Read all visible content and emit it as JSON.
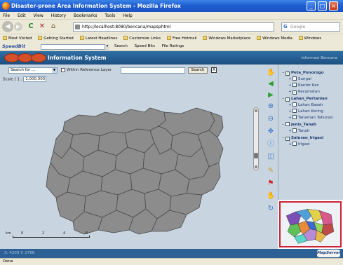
{
  "window": {
    "title": "Disaster-prone Area Information System - Mozilla Firefox",
    "min": "_",
    "max": "□",
    "close": "×"
  },
  "menu": [
    "File",
    "Edit",
    "View",
    "History",
    "Bookmarks",
    "Tools",
    "Help"
  ],
  "nav": {
    "back": "◀",
    "forward": "▶",
    "reload": "C",
    "stop": "✕",
    "home": "⌂",
    "url": "http://localhost:8080/bencana/mapsphtml",
    "star": "☆",
    "search_label": "G",
    "search_placeholder": "Google"
  },
  "bookmarks": [
    "Most Visited",
    "Getting Started",
    "Latest Headlines",
    "Customize Links",
    "Free Hotmail",
    "Windows Marketplace",
    "Windows Media",
    "Windows"
  ],
  "speedbar": {
    "logo": "SpeedBit",
    "items": [
      "Search",
      "Speed Bits",
      "File Ratings"
    ]
  },
  "app": {
    "title": "Information System",
    "right_text": "Informasi Bencana"
  },
  "map_toolbar": {
    "search_select": "Search for ...",
    "checkbox_label": "Within Reference Layer",
    "search_button": "Search",
    "clear": "X",
    "scale_label": "Scale [ 1 :",
    "scale_value": "1,000,000"
  },
  "scalebar": {
    "unit": "km",
    "ticks": [
      "0",
      "2",
      "4",
      "6"
    ]
  },
  "layers": [
    {
      "type": "group",
      "label": "Peta_Ponorogo",
      "expander": "-",
      "checked": true
    },
    {
      "type": "item",
      "label": "Sungai",
      "expander": "+",
      "checked": false
    },
    {
      "type": "item",
      "label": "Kantor Kec",
      "expander": "+",
      "checked": false
    },
    {
      "type": "item",
      "label": "Kecamatan",
      "expander": "+",
      "checked": true
    },
    {
      "type": "group",
      "label": "Lahan_Pertanian",
      "expander": "-",
      "checked": true
    },
    {
      "type": "item",
      "label": "Lahan Basah",
      "expander": "+",
      "checked": false
    },
    {
      "type": "item",
      "label": "Lahan Kering",
      "expander": "+",
      "checked": false
    },
    {
      "type": "item",
      "label": "Tanaman Tahunan",
      "expander": "+",
      "checked": false
    },
    {
      "type": "group",
      "label": "Jenis_Tanah",
      "expander": "-",
      "checked": false
    },
    {
      "type": "item",
      "label": "Tanah",
      "expander": "+",
      "checked": false
    },
    {
      "type": "group",
      "label": "Saluran_Irigasi",
      "expander": "-",
      "checked": true
    },
    {
      "type": "item",
      "label": "Irigasi",
      "expander": "+",
      "checked": false
    }
  ],
  "status": {
    "coords": "X: 4203   Y: 2768",
    "logo": "MapServer"
  },
  "browser_status": "Done",
  "colors": {
    "map_fill": "#8c8c8c",
    "map_border": "#4a4a4a",
    "panel_bg": "#c8d4e0",
    "header_bg": "#1d4f80",
    "overview_border": "#cc2233"
  }
}
